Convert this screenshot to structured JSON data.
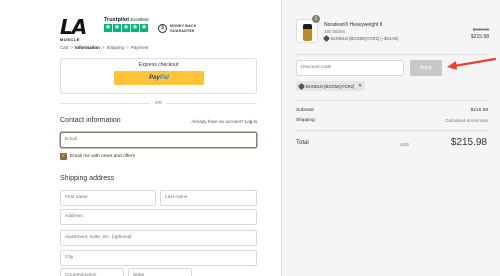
{
  "brand": {
    "logo_text": "LA",
    "logo_sub": "MUSCLE"
  },
  "trustpilot": {
    "name": "Trustpilot",
    "suffix": "Excellent",
    "stars": 5,
    "color": "#00b67a"
  },
  "guarantee": {
    "line1": "MONEY BACK",
    "line2": "GUARANTEE",
    "icon": "dollar-refresh-icon"
  },
  "breadcrumb": {
    "cart": "Cart",
    "information": "Information",
    "shipping": "Shipping",
    "payment": "Payment",
    "sep": ">"
  },
  "express": {
    "title": "Express checkout",
    "paypal_a": "Pay",
    "paypal_b": "Pal",
    "color": "#ffc439"
  },
  "divider": {
    "or": "OR"
  },
  "contact": {
    "title": "Contact information",
    "login_prompt": "Already have an account?",
    "login_link": "Log in",
    "email_placeholder": "Email",
    "newsletter_label": "Email me with news and offers",
    "newsletter_checked": true
  },
  "shipping_address": {
    "title": "Shipping address",
    "first_name": "First name",
    "last_name": "Last name",
    "address": "Address",
    "apartment": "Apartment, suite, etc. (optional)",
    "city": "City",
    "country": "Country/region",
    "state": "State"
  },
  "order": {
    "product_name": "Noratean® Heavyweight II",
    "product_sub": "180 Tablets",
    "quantity": "1",
    "discount_line": "BUNDLE-[BGGMQYGR2] (−$24.00)",
    "price_old": "$239.98",
    "price_new": "$215.98",
    "discount_placeholder": "Discount code",
    "apply_label": "Apply",
    "applied_code": "BUNDLE-[BGGMQYGR2]",
    "subtotal_label": "Subtotal",
    "subtotal_value": "$215.98",
    "shipping_label": "Shipping",
    "shipping_value": "Calculated at next step",
    "total_label": "Total",
    "total_currency": "USD",
    "total_value": "$215.98"
  },
  "colors": {
    "accent": "#8a6c3f",
    "arrow": "#e8432f",
    "sidebar_bg": "#f5f5f5"
  }
}
